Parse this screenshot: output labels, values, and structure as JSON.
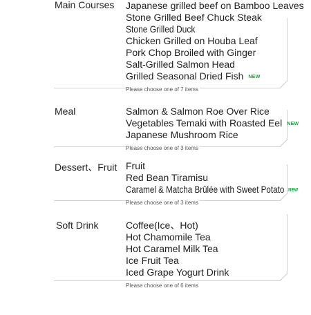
{
  "sections": [
    {
      "category": "Main Courses",
      "items": [
        {
          "name": "Japanese grilled beef on Bamboo Leaves",
          "badge": ""
        },
        {
          "name": "Stone Grilled Beef Chuck Steak",
          "badge": ""
        },
        {
          "name": "Stone Grilled Duck",
          "badge": ""
        },
        {
          "name": "Chicken Grilled on Houba Leaf",
          "badge": ""
        },
        {
          "name": "Pork Chop Broiled with Ginger",
          "badge": ""
        },
        {
          "name": "Salt-Grilled Salmon Head",
          "badge": ""
        },
        {
          "name": "Grilled Seasonal Dried Fish",
          "badge": "NEW"
        }
      ],
      "note": "Please choose one of 7 items"
    },
    {
      "category": "Meal",
      "items": [
        {
          "name": "Salmon & Salmon Roe Over Rice",
          "badge": ""
        },
        {
          "name": "Vegetables Temaki with Roasted Eel",
          "badge": "NEW"
        },
        {
          "name": "Japanese Mushroom Rice",
          "badge": ""
        }
      ],
      "note": "Please choose one of 3 items"
    },
    {
      "category": "Dessert、Fruit",
      "items": [
        {
          "name": "Fruit",
          "badge": ""
        },
        {
          "name": "Red Bean Tiramisu",
          "badge": ""
        },
        {
          "name": "Caramel &  Matcha Brûlée with Sweet Potato",
          "badge": "NEW"
        }
      ],
      "note": "Please choose one of 3 items"
    },
    {
      "category": "Soft Drink",
      "items": [
        {
          "name": "Coffee(Ice、Hot)",
          "badge": ""
        },
        {
          "name": "Hot Chamomile Tea",
          "badge": ""
        },
        {
          "name": "Hot Caramel Milk Tea",
          "badge": ""
        },
        {
          "name": "Ice Fruit Tea",
          "badge": ""
        },
        {
          "name": "Iced Grape Yogurt Drink",
          "badge": ""
        }
      ],
      "note": "Please choose one of 6 items"
    }
  ],
  "colors": {
    "badge": "#2e9a43",
    "frame": "#cfcfcf",
    "text": "#222222"
  }
}
